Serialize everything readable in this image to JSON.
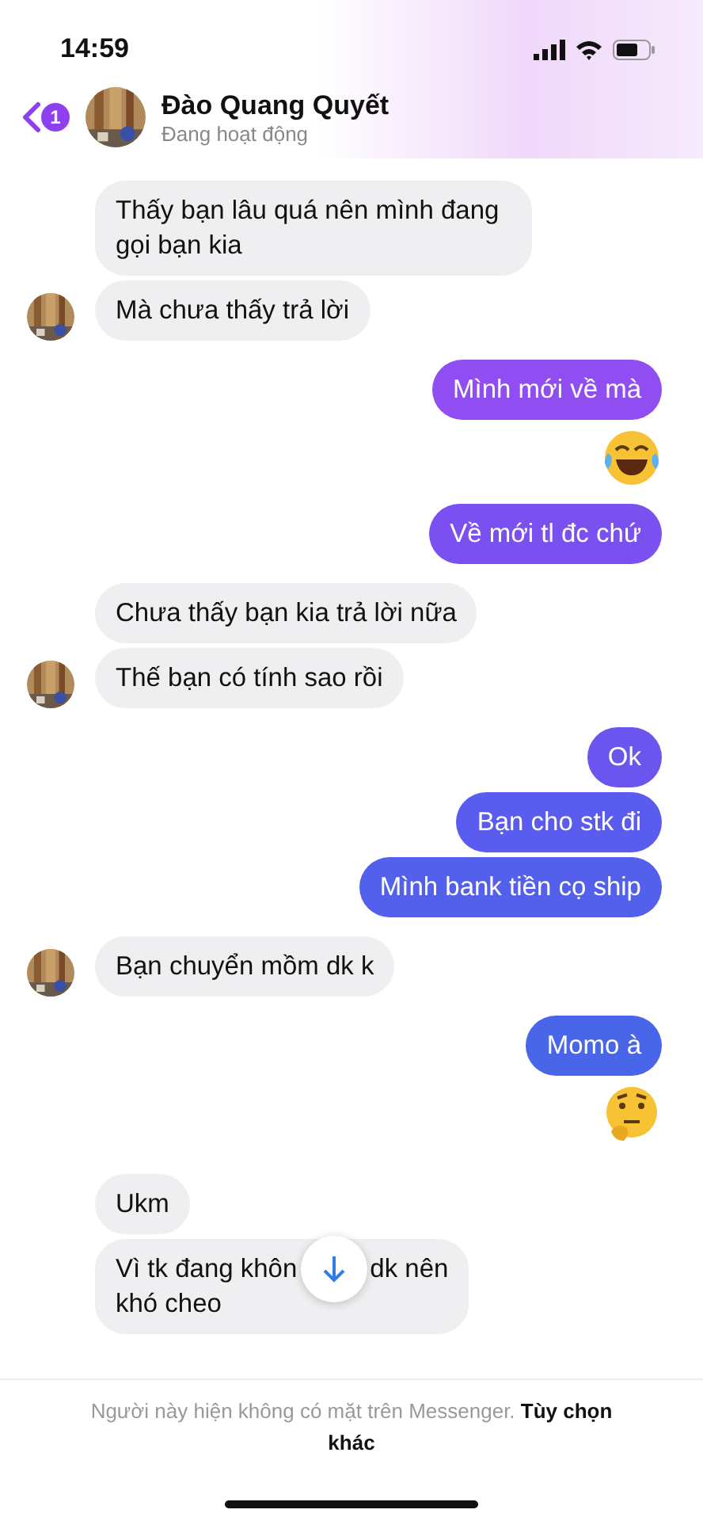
{
  "status_bar": {
    "time": "14:59"
  },
  "header": {
    "back_badge": "1",
    "name": "Đào Quang Quyết",
    "status": "Đang hoạt động"
  },
  "messages": [
    {
      "outgoing": false,
      "kind": "text",
      "text": "Thấy bạn lâu quá nên mình đang gọi bạn kia",
      "avatar": false
    },
    {
      "outgoing": false,
      "kind": "text",
      "text": "Mà chưa thấy trả lời",
      "avatar": true
    },
    {
      "outgoing": true,
      "kind": "text",
      "text": "Mình mới về mà"
    },
    {
      "outgoing": true,
      "kind": "laugh-emoji"
    },
    {
      "outgoing": true,
      "kind": "text",
      "text": "Về mới tl đc chứ"
    },
    {
      "outgoing": false,
      "kind": "text",
      "text": "Chưa thấy bạn kia trả lời nữa",
      "avatar": false
    },
    {
      "outgoing": false,
      "kind": "text",
      "text": "Thế bạn có tính sao rồi",
      "avatar": true
    },
    {
      "outgoing": true,
      "kind": "text",
      "text": "Ok"
    },
    {
      "outgoing": true,
      "kind": "text",
      "text": "Bạn cho stk đi"
    },
    {
      "outgoing": true,
      "kind": "text",
      "text": "Mình bank tiền cọ ship"
    },
    {
      "outgoing": false,
      "kind": "text",
      "text": "Bạn chuyển mồm dk k",
      "avatar": true
    },
    {
      "outgoing": true,
      "kind": "text",
      "text": "Momo à"
    },
    {
      "outgoing": true,
      "kind": "think-emoji"
    },
    {
      "outgoing": false,
      "kind": "text",
      "text": "Ukm",
      "avatar": false
    },
    {
      "outgoing": false,
      "kind": "covered-text",
      "text_before": "Vì tk đang khôn",
      "text_after": "dk nên",
      "text_next_line": "khó cheo",
      "avatar": false
    }
  ],
  "footer": {
    "notice": "Người này hiện không có mặt trên Messenger. **Tùy chọn khác**"
  }
}
